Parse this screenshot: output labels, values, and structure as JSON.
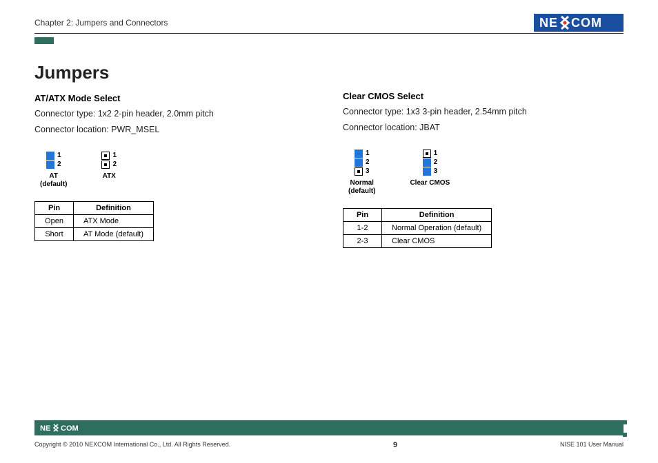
{
  "header": {
    "chapter": "Chapter 2: Jumpers and Connectors",
    "brand_main": "NE",
    "brand_end": "COM"
  },
  "left": {
    "section_title": "Jumpers",
    "heading": "AT/ATX Mode Select",
    "line1": "Connector type: 1x2 2-pin header, 2.0mm pitch",
    "line2": "Connector location: PWR_MSEL",
    "jumpers": [
      {
        "label_top": "AT",
        "label_sub": "(default)",
        "pins": [
          "1",
          "2"
        ],
        "filled": [
          true,
          true
        ]
      },
      {
        "label_top": "ATX",
        "label_sub": "",
        "pins": [
          "1",
          "2"
        ],
        "filled": [
          false,
          false
        ]
      }
    ],
    "table": {
      "headers": [
        "Pin",
        "Definition"
      ],
      "rows": [
        [
          "Open",
          "ATX Mode"
        ],
        [
          "Short",
          "AT Mode (default)"
        ]
      ]
    }
  },
  "right": {
    "heading": "Clear CMOS Select",
    "line1": "Connector type: 1x3 3-pin header, 2.54mm pitch",
    "line2": "Connector location: JBAT",
    "jumpers": [
      {
        "label_top": "Normal",
        "label_sub": "(default)",
        "pins": [
          "1",
          "2",
          "3"
        ],
        "filled": [
          true,
          true,
          false
        ]
      },
      {
        "label_top": "Clear CMOS",
        "label_sub": "",
        "pins": [
          "1",
          "2",
          "3"
        ],
        "filled": [
          false,
          true,
          true
        ]
      }
    ],
    "table": {
      "headers": [
        "Pin",
        "Definition"
      ],
      "rows": [
        [
          "1-2",
          "Normal Operation (default)"
        ],
        [
          "2-3",
          "Clear CMOS"
        ]
      ]
    }
  },
  "footer": {
    "copyright": "Copyright © 2010 NEXCOM International Co., Ltd. All Rights Reserved.",
    "page": "9",
    "doc": "NISE 101 User Manual"
  }
}
